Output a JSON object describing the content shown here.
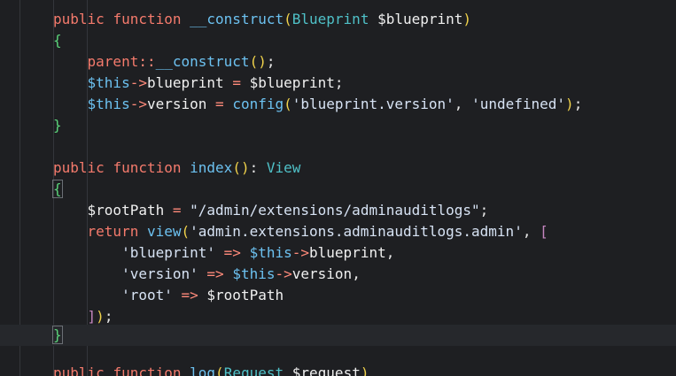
{
  "code": {
    "lines": [
      "public function __construct(Blueprint $blueprint)",
      "{",
      "    parent::__construct();",
      "    $this->blueprint = $blueprint;",
      "    $this->version = config('blueprint.version', 'undefined');",
      "}",
      "",
      "public function index(): View",
      "{",
      "    $rootPath = \"/admin/extensions/adminauditlogs\";",
      "    return view('admin.extensions.adminauditlogs.admin', [",
      "        'blueprint' => $this->blueprint,",
      "        'version' => $this->version,",
      "        'root' => $rootPath",
      "    ]);",
      "}",
      "",
      "public function log(Request $request)"
    ],
    "current_line": 16
  },
  "colors": {
    "background": "#1e1f22",
    "keyword": "#f47a6c",
    "function": "#6cc1f0",
    "string": "#d7e3f4",
    "variable": "#f0f0f0",
    "bracket": "#5bd37a"
  }
}
